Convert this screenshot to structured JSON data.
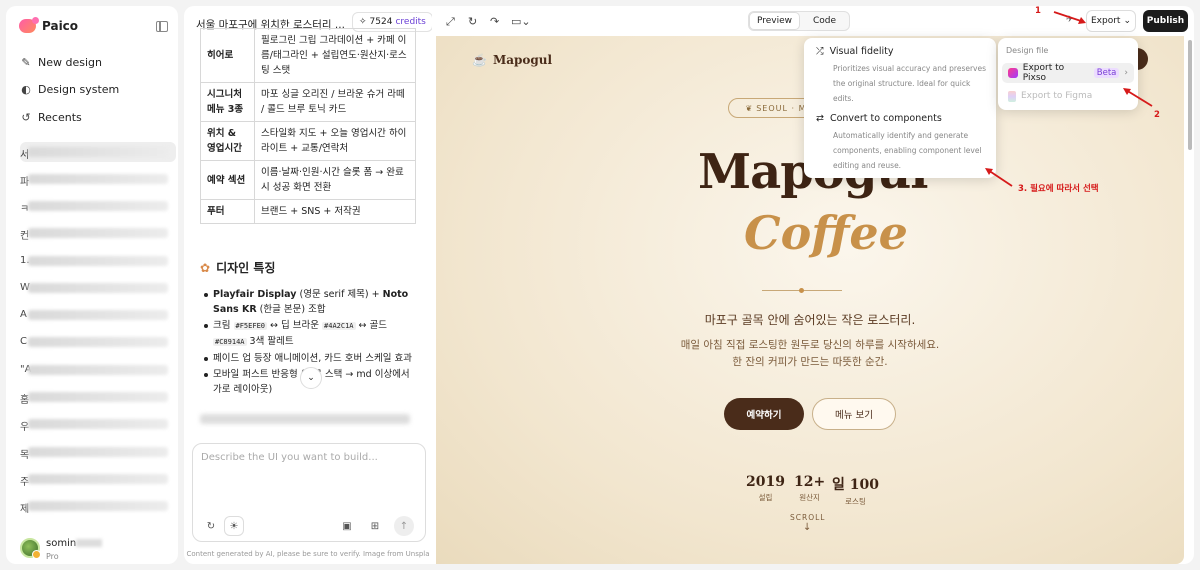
{
  "sidebar": {
    "brand": "Paico",
    "nav": [
      {
        "label": "New design",
        "icon": "edit-icon"
      },
      {
        "label": "Design system",
        "icon": "palette-icon"
      },
      {
        "label": "Recents",
        "icon": "history-icon"
      }
    ],
    "recent_leads": [
      "서",
      "파",
      "ㅋ",
      "컨",
      "1.",
      "W",
      "A",
      "C",
      "\"A",
      "홈",
      "우",
      "목",
      "주",
      "제"
    ],
    "user": {
      "name": "somin",
      "plan": "Pro"
    }
  },
  "chat": {
    "title": "서울 마포구에 위치한 로스터리 ...",
    "credits_value": "7524",
    "credits_label": "credits",
    "table_rows": [
      {
        "name": "히어로",
        "desc": "필로그린 그립 그라데이션 + 카페 이름/태그라인 + 설립연도·원산지·로스팅 스탯"
      },
      {
        "name": "시그니처 메뉴 3종",
        "desc": "마포 싱글 오리진 / 브라운 슈거 라떼 / 콜드 브루 토닉 카드"
      },
      {
        "name": "위치 & 영업시간",
        "desc": "스타일화 지도 + 오늘 영업시간 하이라이트 + 교통/연락처"
      },
      {
        "name": "예약 섹션",
        "desc": "이름·날짜·인원·시간 슬롯 폼 → 완료 시 성공 화면 전환"
      },
      {
        "name": "푸터",
        "desc": "브랜드 + SNS + 저작권"
      }
    ],
    "section_title": "디자인 특징",
    "bullets": {
      "b1_a": "Playfair Display",
      "b1_b": " (영문 serif 제목) + ",
      "b1_c": "Noto Sans KR",
      "b1_d": " (한글 본문) 조합",
      "b2_a": "크림 ",
      "b2_c1": "#F5EFE0",
      "b2_b": " ↔ 딥 브라운 ",
      "b2_c2": "#4A2C1A",
      "b2_c": " ↔ 골드 ",
      "b2_c3": "#C8914A",
      "b2_d": " 3색 팔레트",
      "b3": "페이드 업 등장 애니메이션, 카드 호버 스케일 효과",
      "b4": "모바일 퍼스트 반응형 (세로 스택 → md 이상에서 가로 레이아웃)"
    },
    "composer_placeholder": "Describe the UI you want to build...",
    "disclaimer": "Content generated by AI, please be sure to verify. Image from Unspla"
  },
  "toolbar": {
    "preview_tab": "Preview",
    "code_tab": "Code",
    "export_label": "Export",
    "publish_label": "Publish"
  },
  "site": {
    "logo": "Mapogul",
    "location_pill": "SEOUL · M",
    "heading_main": "Mapogul",
    "heading_sub": "Coffee",
    "tagline": "마포구 골목 안에 숨어있는 작은 로스터리.",
    "desc_1": "매일 아침 직접 로스팅한 원두로 당신의 하루를 시작하세요.",
    "desc_2": "한 잔의 커피가 만드는 따뜻한 순간.",
    "cta_primary": "예약하기",
    "cta_secondary": "메뉴 보기",
    "stats": [
      {
        "value": "2019",
        "label": "설립"
      },
      {
        "value": "12+",
        "label": "원산지"
      },
      {
        "value": "일 100",
        "label": "로스팅"
      }
    ],
    "scroll_label": "SCROLL"
  },
  "export_menu": {
    "opt1_title": "Visual fidelity",
    "opt1_desc": "Prioritizes visual accuracy and preserves the original structure. Ideal for quick edits.",
    "opt2_title": "Convert to components",
    "opt2_desc": "Automatically identify and generate components, enabling component level editing and reuse."
  },
  "design_file_menu": {
    "header": "Design file",
    "pixso_label": "Export to Pixso",
    "beta": "Beta",
    "figma_label": "Export to Figma"
  },
  "annotations": {
    "a1": "1",
    "a2": "2",
    "a3": "3. 필요에 따라서 선택"
  },
  "colors": {
    "cream": "#F5EFE0",
    "brown": "#4A2C1A",
    "gold": "#C8914A",
    "annotation_red": "#D61A1A"
  }
}
